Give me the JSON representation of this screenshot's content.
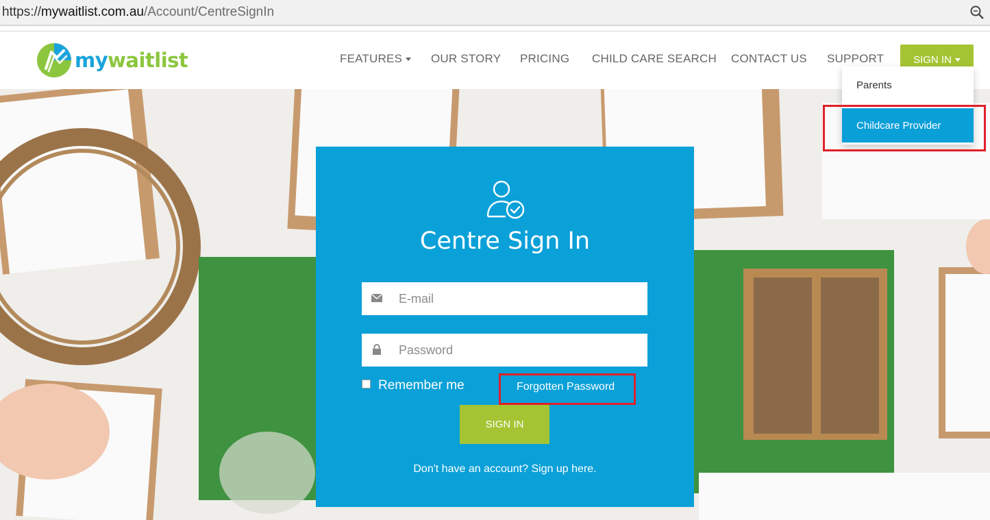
{
  "browser": {
    "url_scheme": "https://",
    "url_host": "mywaitlist.com.au",
    "url_path": "/Account/CentreSignIn",
    "zoom_icon": "zoom-icon"
  },
  "header": {
    "logo": {
      "my": "my",
      "waitlist": "waitlist"
    },
    "nav": {
      "features": "FEATURES",
      "our_story": "OUR STORY",
      "pricing": "PRICING",
      "child_care_search": "CHILD CARE SEARCH",
      "contact_us": "CONTACT US",
      "support": "SUPPORT",
      "sign_in": "SIGN IN"
    },
    "dropdown": {
      "parents": "Parents",
      "childcare_provider": "Childcare Provider"
    }
  },
  "signin_card": {
    "title": "Centre Sign In",
    "email_placeholder": "E-mail",
    "password_placeholder": "Password",
    "remember_me": "Remember me",
    "forgot_password": "Forgotten Password",
    "submit": "SIGN IN",
    "signup_link": "Don't have an account? Sign up here."
  },
  "colors": {
    "brand_blue": "#0aa0d8",
    "brand_green": "#a5c433",
    "highlight_red": "#e0202a"
  }
}
